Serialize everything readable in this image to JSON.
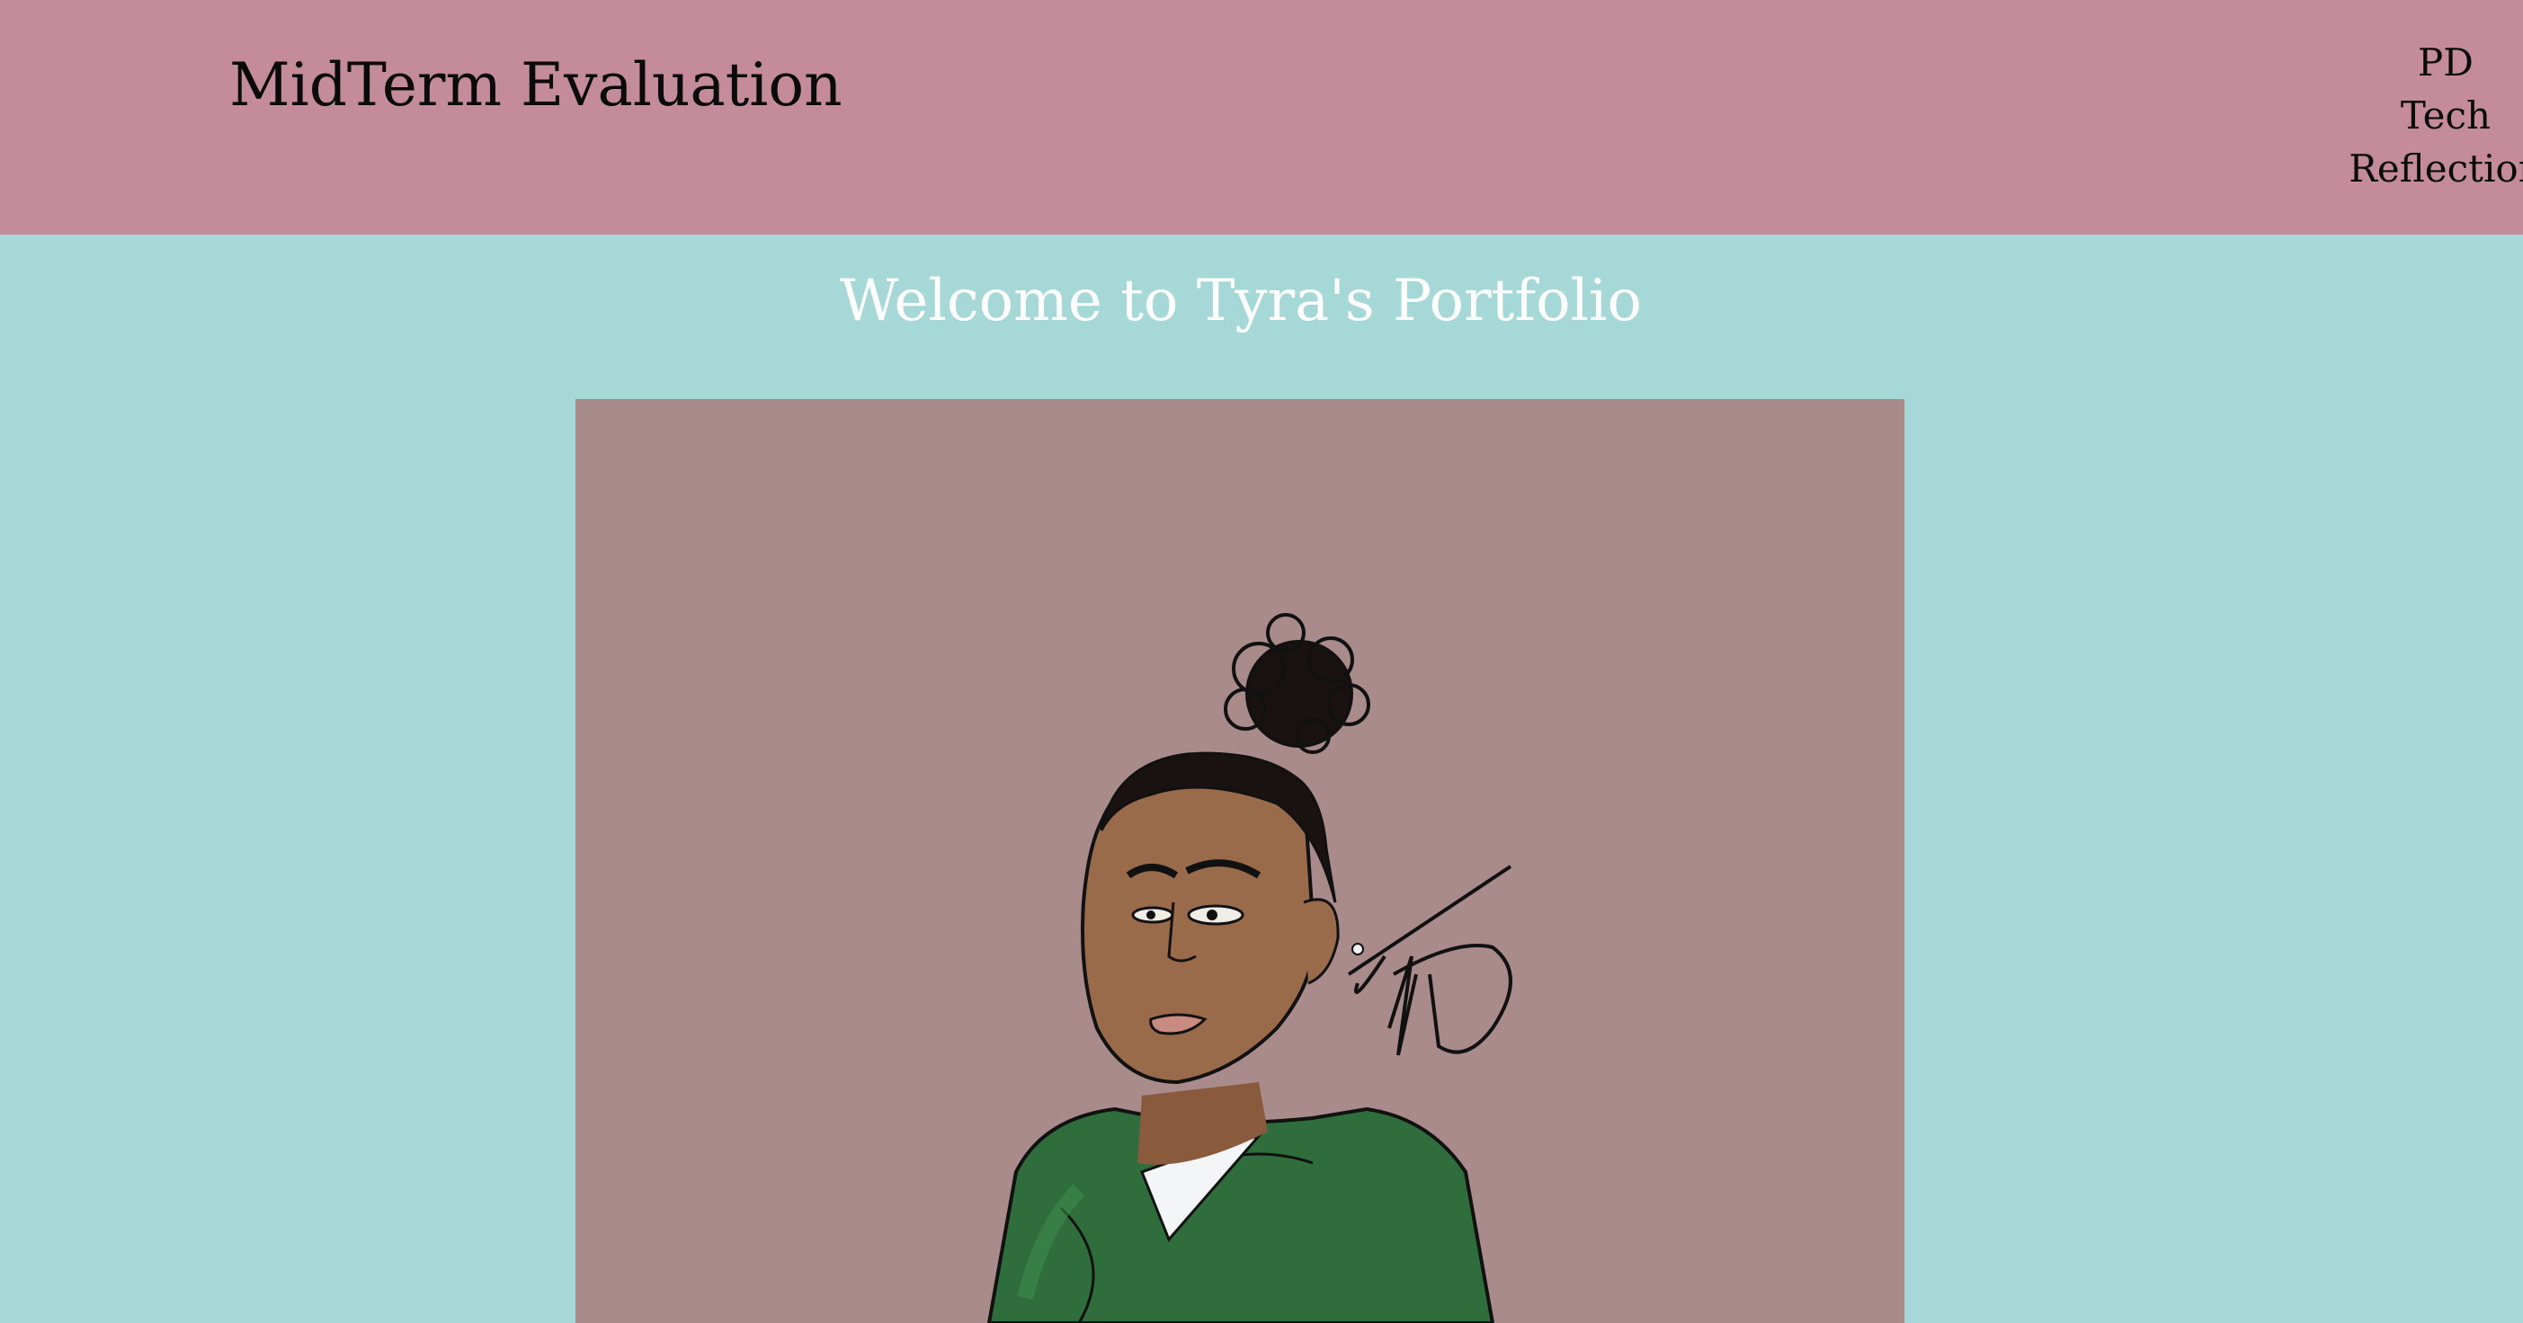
{
  "header": {
    "title": "MidTerm Evaluation",
    "nav": [
      "PD",
      "Tech",
      "Reflection"
    ]
  },
  "main": {
    "heading": "Welcome to Tyra's Portfolio",
    "portrait_alt": "Illustrated self-portrait"
  },
  "colors": {
    "header_bg": "#c48c9b",
    "page_bg": "#a6d8d7",
    "portrait_bg": "#a98b8b",
    "heading_text": "#ffffff",
    "header_text": "#0a0a0a"
  }
}
